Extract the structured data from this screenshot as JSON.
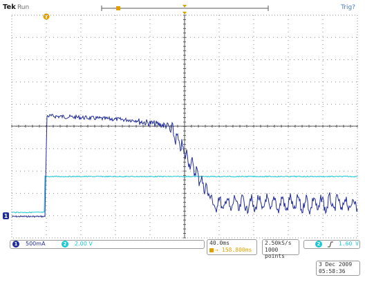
{
  "header": {
    "brand": "Tek",
    "status": "Run",
    "trigger_status": "Trig?"
  },
  "markers": {
    "trigger_position_marker": "T",
    "ch1_ground_marker": "1"
  },
  "readouts": {
    "ch1": {
      "number": "1",
      "scale": "500mA",
      "color": "#1f2a9c"
    },
    "ch2": {
      "number": "2",
      "scale": "2.00 V",
      "color": "#18c8d8"
    },
    "timebase": "40.0ms",
    "delay": "158.800ms",
    "sample_rate": "2.50kS/s",
    "record_length": "1000 points",
    "trigger": {
      "source": "2",
      "slope": "rising",
      "level": "1.60 V"
    },
    "date": "3 Dec  2009",
    "time": "05:58:36"
  },
  "colors": {
    "ch1_trace": "#1f2a9c",
    "ch2_trace": "#18c8d8",
    "grid": "#555555",
    "accent": "#e0a000"
  }
}
